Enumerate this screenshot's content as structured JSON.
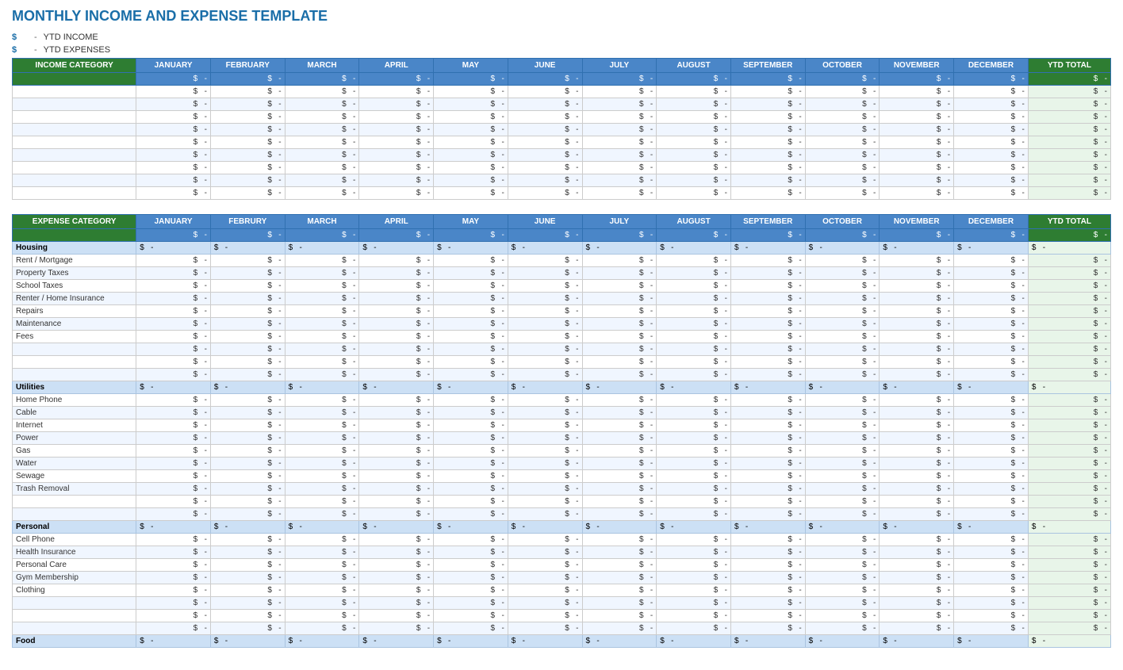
{
  "title": "MONTHLY INCOME AND EXPENSE TEMPLATE",
  "ytd": {
    "income_label": "YTD INCOME",
    "expense_label": "YTD EXPENSES",
    "dollar": "$"
  },
  "months": [
    "JANUARY",
    "FEBRUARY",
    "MARCH",
    "APRIL",
    "MAY",
    "JUNE",
    "JULY",
    "AUGUST",
    "SEPTEMBER",
    "OCTOBER",
    "NOVEMBER",
    "DECEMBER"
  ],
  "ytd_total": "YTD TOTAL",
  "income_category_label": "INCOME CATEGORY",
  "expense_category_label": "EXPENSE CATEGORY",
  "income_rows": [
    {
      "category": "",
      "values": [
        "-",
        "-",
        "-",
        "-",
        "-",
        "-",
        "-",
        "-",
        "-",
        "-",
        "-",
        "-",
        "-"
      ]
    },
    {
      "category": "",
      "values": [
        "-",
        "-",
        "-",
        "-",
        "-",
        "-",
        "-",
        "-",
        "-",
        "-",
        "-",
        "-",
        "-"
      ]
    },
    {
      "category": "",
      "values": [
        "-",
        "-",
        "-",
        "-",
        "-",
        "-",
        "-",
        "-",
        "-",
        "-",
        "-",
        "-",
        "-"
      ]
    },
    {
      "category": "",
      "values": [
        "-",
        "-",
        "-",
        "-",
        "-",
        "-",
        "-",
        "-",
        "-",
        "-",
        "-",
        "-",
        "-"
      ]
    },
    {
      "category": "",
      "values": [
        "-",
        "-",
        "-",
        "-",
        "-",
        "-",
        "-",
        "-",
        "-",
        "-",
        "-",
        "-",
        "-"
      ]
    },
    {
      "category": "",
      "values": [
        "-",
        "-",
        "-",
        "-",
        "-",
        "-",
        "-",
        "-",
        "-",
        "-",
        "-",
        "-",
        "-"
      ]
    },
    {
      "category": "",
      "values": [
        "-",
        "-",
        "-",
        "-",
        "-",
        "-",
        "-",
        "-",
        "-",
        "-",
        "-",
        "-",
        "-"
      ]
    },
    {
      "category": "",
      "values": [
        "-",
        "-",
        "-",
        "-",
        "-",
        "-",
        "-",
        "-",
        "-",
        "-",
        "-",
        "-",
        "-"
      ]
    },
    {
      "category": "",
      "values": [
        "-",
        "-",
        "-",
        "-",
        "-",
        "-",
        "-",
        "-",
        "-",
        "-",
        "-",
        "-",
        "-"
      ]
    }
  ],
  "expense_sections": [
    {
      "name": "Housing",
      "summary_values": [
        "-",
        "-",
        "-",
        "-",
        "-",
        "-",
        "-",
        "-",
        "-",
        "-",
        "-",
        "-",
        "-"
      ],
      "rows": [
        {
          "category": "Rent / Mortgage",
          "values": [
            "-",
            "-",
            "-",
            "-",
            "-",
            "-",
            "-",
            "-",
            "-",
            "-",
            "-",
            "-",
            "-"
          ]
        },
        {
          "category": "Property Taxes",
          "values": [
            "-",
            "-",
            "-",
            "-",
            "-",
            "-",
            "-",
            "-",
            "-",
            "-",
            "-",
            "-",
            "-"
          ]
        },
        {
          "category": "School Taxes",
          "values": [
            "-",
            "-",
            "-",
            "-",
            "-",
            "-",
            "-",
            "-",
            "-",
            "-",
            "-",
            "-",
            "-"
          ]
        },
        {
          "category": "Renter / Home Insurance",
          "values": [
            "-",
            "-",
            "-",
            "-",
            "-",
            "-",
            "-",
            "-",
            "-",
            "-",
            "-",
            "-",
            "-"
          ]
        },
        {
          "category": "Repairs",
          "values": [
            "-",
            "-",
            "-",
            "-",
            "-",
            "-",
            "-",
            "-",
            "-",
            "-",
            "-",
            "-",
            "-"
          ]
        },
        {
          "category": "Maintenance",
          "values": [
            "-",
            "-",
            "-",
            "-",
            "-",
            "-",
            "-",
            "-",
            "-",
            "-",
            "-",
            "-",
            "-"
          ]
        },
        {
          "category": "Fees",
          "values": [
            "-",
            "-",
            "-",
            "-",
            "-",
            "-",
            "-",
            "-",
            "-",
            "-",
            "-",
            "-",
            "-"
          ]
        },
        {
          "category": "",
          "values": [
            "-",
            "-",
            "-",
            "-",
            "-",
            "-",
            "-",
            "-",
            "-",
            "-",
            "-",
            "-",
            "-"
          ]
        },
        {
          "category": "",
          "values": [
            "-",
            "-",
            "-",
            "-",
            "-",
            "-",
            "-",
            "-",
            "-",
            "-",
            "-",
            "-",
            "-"
          ]
        },
        {
          "category": "",
          "values": [
            "-",
            "-",
            "-",
            "-",
            "-",
            "-",
            "-",
            "-",
            "-",
            "-",
            "-",
            "-",
            "-"
          ]
        }
      ]
    },
    {
      "name": "Utilities",
      "summary_values": [
        "-",
        "-",
        "-",
        "-",
        "-",
        "-",
        "-",
        "-",
        "-",
        "-",
        "-",
        "-",
        "-"
      ],
      "rows": [
        {
          "category": "Home Phone",
          "values": [
            "-",
            "-",
            "-",
            "-",
            "-",
            "-",
            "-",
            "-",
            "-",
            "-",
            "-",
            "-",
            "-"
          ]
        },
        {
          "category": "Cable",
          "values": [
            "-",
            "-",
            "-",
            "-",
            "-",
            "-",
            "-",
            "-",
            "-",
            "-",
            "-",
            "-",
            "-"
          ]
        },
        {
          "category": "Internet",
          "values": [
            "-",
            "-",
            "-",
            "-",
            "-",
            "-",
            "-",
            "-",
            "-",
            "-",
            "-",
            "-",
            "-"
          ]
        },
        {
          "category": "Power",
          "values": [
            "-",
            "-",
            "-",
            "-",
            "-",
            "-",
            "-",
            "-",
            "-",
            "-",
            "-",
            "-",
            "-"
          ]
        },
        {
          "category": "Gas",
          "values": [
            "-",
            "-",
            "-",
            "-",
            "-",
            "-",
            "-",
            "-",
            "-",
            "-",
            "-",
            "-",
            "-"
          ]
        },
        {
          "category": "Water",
          "values": [
            "-",
            "-",
            "-",
            "-",
            "-",
            "-",
            "-",
            "-",
            "-",
            "-",
            "-",
            "-",
            "-"
          ]
        },
        {
          "category": "Sewage",
          "values": [
            "-",
            "-",
            "-",
            "-",
            "-",
            "-",
            "-",
            "-",
            "-",
            "-",
            "-",
            "-",
            "-"
          ]
        },
        {
          "category": "Trash Removal",
          "values": [
            "-",
            "-",
            "-",
            "-",
            "-",
            "-",
            "-",
            "-",
            "-",
            "-",
            "-",
            "-",
            "-"
          ]
        },
        {
          "category": "",
          "values": [
            "-",
            "-",
            "-",
            "-",
            "-",
            "-",
            "-",
            "-",
            "-",
            "-",
            "-",
            "-",
            "-"
          ]
        },
        {
          "category": "",
          "values": [
            "-",
            "-",
            "-",
            "-",
            "-",
            "-",
            "-",
            "-",
            "-",
            "-",
            "-",
            "-",
            "-"
          ]
        }
      ]
    },
    {
      "name": "Personal",
      "summary_values": [
        "-",
        "-",
        "-",
        "-",
        "-",
        "-",
        "-",
        "-",
        "-",
        "-",
        "-",
        "-",
        "-"
      ],
      "rows": [
        {
          "category": "Cell Phone",
          "values": [
            "-",
            "-",
            "-",
            "-",
            "-",
            "-",
            "-",
            "-",
            "-",
            "-",
            "-",
            "-",
            "-"
          ]
        },
        {
          "category": "Health Insurance",
          "values": [
            "-",
            "-",
            "-",
            "-",
            "-",
            "-",
            "-",
            "-",
            "-",
            "-",
            "-",
            "-",
            "-"
          ]
        },
        {
          "category": "Personal Care",
          "values": [
            "-",
            "-",
            "-",
            "-",
            "-",
            "-",
            "-",
            "-",
            "-",
            "-",
            "-",
            "-",
            "-"
          ]
        },
        {
          "category": "Gym Membership",
          "values": [
            "-",
            "-",
            "-",
            "-",
            "-",
            "-",
            "-",
            "-",
            "-",
            "-",
            "-",
            "-",
            "-"
          ]
        },
        {
          "category": "Clothing",
          "values": [
            "-",
            "-",
            "-",
            "-",
            "-",
            "-",
            "-",
            "-",
            "-",
            "-",
            "-",
            "-",
            "-"
          ]
        },
        {
          "category": "",
          "values": [
            "-",
            "-",
            "-",
            "-",
            "-",
            "-",
            "-",
            "-",
            "-",
            "-",
            "-",
            "-",
            "-"
          ]
        },
        {
          "category": "",
          "values": [
            "-",
            "-",
            "-",
            "-",
            "-",
            "-",
            "-",
            "-",
            "-",
            "-",
            "-",
            "-",
            "-"
          ]
        },
        {
          "category": "",
          "values": [
            "-",
            "-",
            "-",
            "-",
            "-",
            "-",
            "-",
            "-",
            "-",
            "-",
            "-",
            "-",
            "-"
          ]
        }
      ]
    },
    {
      "name": "Food",
      "summary_values": [
        "-",
        "-",
        "-",
        "-",
        "-",
        "-",
        "-",
        "-",
        "-",
        "-",
        "-",
        "-",
        "-"
      ],
      "rows": []
    }
  ]
}
